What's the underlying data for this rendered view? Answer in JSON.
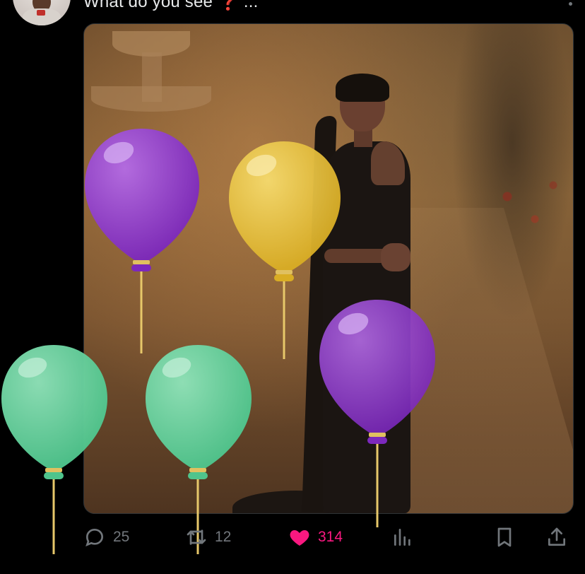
{
  "tweet": {
    "text": "What do you see ❓ ...",
    "image_alt": "photo"
  },
  "actions": {
    "replies": "25",
    "reposts": "12",
    "likes": "314",
    "liked": true
  },
  "colors": {
    "background": "#000000",
    "text": "#e7e9ea",
    "muted": "#71767b",
    "like": "#f91880",
    "balloon_purple": "#8a33c9",
    "balloon_yellow": "#e8c33a",
    "balloon_green": "#5fd19b"
  },
  "icons": {
    "reply": "speech-bubble-icon",
    "repost": "repost-arrows-icon",
    "like": "heart-icon",
    "views": "bar-chart-icon",
    "bookmark": "bookmark-icon",
    "share": "share-upload-icon"
  }
}
